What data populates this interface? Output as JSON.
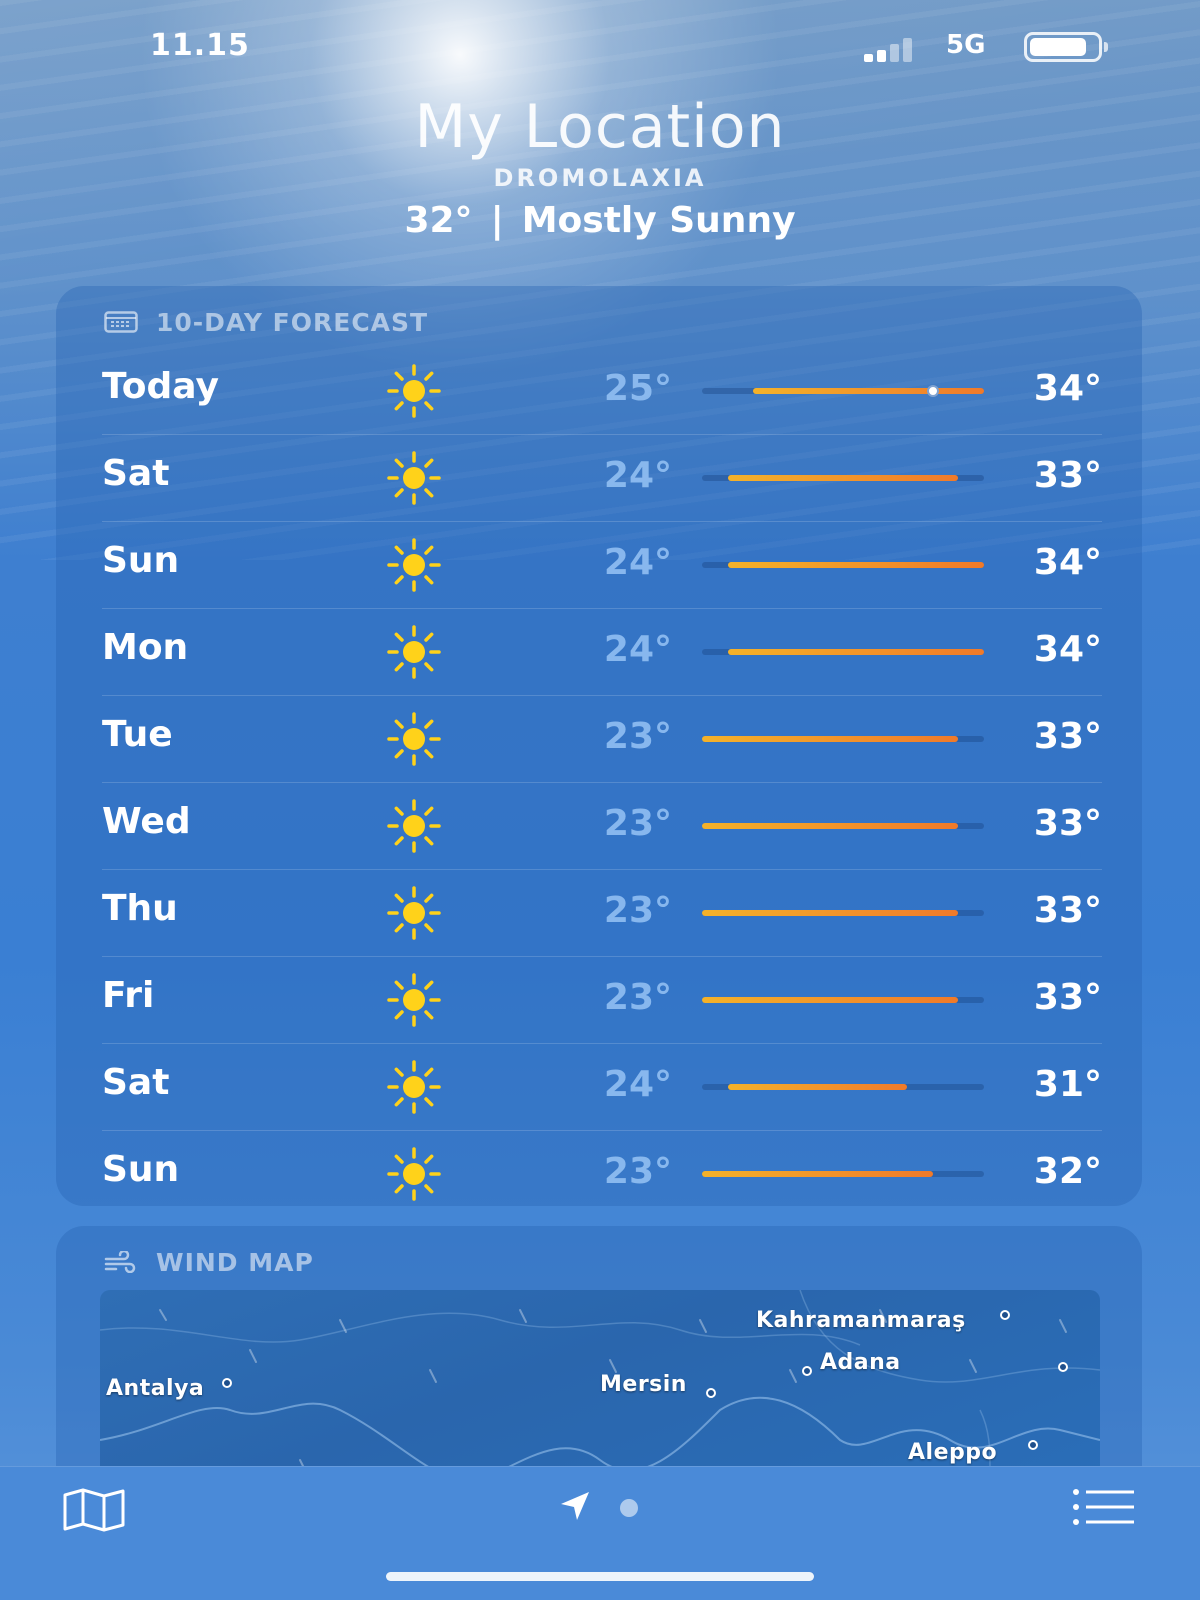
{
  "status_bar": {
    "time": "11.15",
    "network": "5G",
    "battery_level": 0.85,
    "signal_bars": 2
  },
  "header": {
    "title": "My Location",
    "subtitle": "DROMOLAXIA",
    "current_temp": "32°",
    "separator": "|",
    "condition": "Mostly Sunny"
  },
  "forecast": {
    "label": "10-DAY FORECAST",
    "icon": "calendar-icon",
    "range_min": 23,
    "range_max": 34,
    "days": [
      {
        "day": "Today",
        "icon": "sun-icon",
        "low": "25°",
        "high": "34°",
        "low_val": 25,
        "high_val": 34,
        "current_val": 32
      },
      {
        "day": "Sat",
        "icon": "sun-icon",
        "low": "24°",
        "high": "33°",
        "low_val": 24,
        "high_val": 33
      },
      {
        "day": "Sun",
        "icon": "sun-icon",
        "low": "24°",
        "high": "34°",
        "low_val": 24,
        "high_val": 34
      },
      {
        "day": "Mon",
        "icon": "sun-icon",
        "low": "24°",
        "high": "34°",
        "low_val": 24,
        "high_val": 34
      },
      {
        "day": "Tue",
        "icon": "sun-icon",
        "low": "23°",
        "high": "33°",
        "low_val": 23,
        "high_val": 33
      },
      {
        "day": "Wed",
        "icon": "sun-icon",
        "low": "23°",
        "high": "33°",
        "low_val": 23,
        "high_val": 33
      },
      {
        "day": "Thu",
        "icon": "sun-icon",
        "low": "23°",
        "high": "33°",
        "low_val": 23,
        "high_val": 33
      },
      {
        "day": "Fri",
        "icon": "sun-icon",
        "low": "23°",
        "high": "33°",
        "low_val": 23,
        "high_val": 33
      },
      {
        "day": "Sat",
        "icon": "sun-icon",
        "low": "24°",
        "high": "31°",
        "low_val": 24,
        "high_val": 31
      },
      {
        "day": "Sun",
        "icon": "sun-icon",
        "low": "23°",
        "high": "32°",
        "low_val": 23,
        "high_val": 32
      }
    ]
  },
  "wind_map": {
    "label": "WIND MAP",
    "icon": "wind-icon",
    "cities": {
      "kahramanmaras": "Kahramanmaraş",
      "adana": "Adana",
      "antalya": "Antalya",
      "mersin": "Mersin",
      "aleppo": "Aleppo"
    }
  },
  "toolbar": {
    "map_icon": "map-icon",
    "location_icon": "location-arrow-icon",
    "list_icon": "list-icon"
  },
  "colors": {
    "bar_start": "#f4b22a",
    "bar_end": "#f07a2a",
    "low_temp": "#96c3f5"
  }
}
